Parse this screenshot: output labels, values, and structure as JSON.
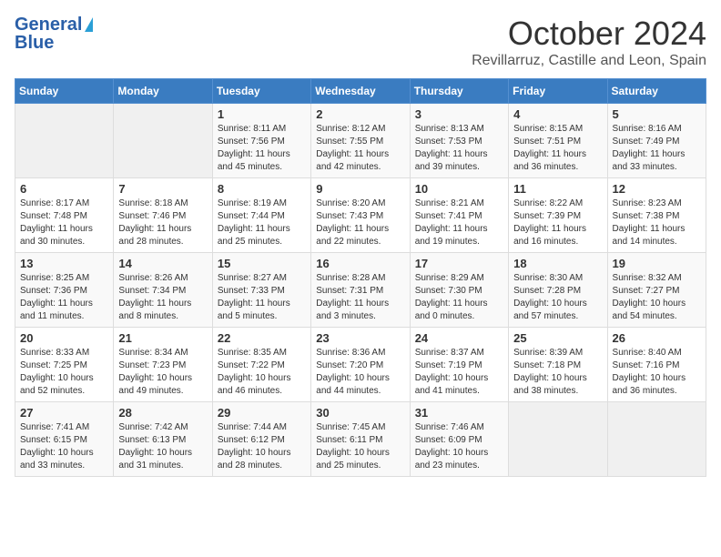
{
  "logo": {
    "line1": "General",
    "line2": "Blue"
  },
  "header": {
    "month": "October 2024",
    "location": "Revillarruz, Castille and Leon, Spain"
  },
  "weekdays": [
    "Sunday",
    "Monday",
    "Tuesday",
    "Wednesday",
    "Thursday",
    "Friday",
    "Saturday"
  ],
  "weeks": [
    [
      {
        "day": "",
        "empty": true
      },
      {
        "day": "",
        "empty": true
      },
      {
        "day": "1",
        "sunrise": "Sunrise: 8:11 AM",
        "sunset": "Sunset: 7:56 PM",
        "daylight": "Daylight: 11 hours and 45 minutes."
      },
      {
        "day": "2",
        "sunrise": "Sunrise: 8:12 AM",
        "sunset": "Sunset: 7:55 PM",
        "daylight": "Daylight: 11 hours and 42 minutes."
      },
      {
        "day": "3",
        "sunrise": "Sunrise: 8:13 AM",
        "sunset": "Sunset: 7:53 PM",
        "daylight": "Daylight: 11 hours and 39 minutes."
      },
      {
        "day": "4",
        "sunrise": "Sunrise: 8:15 AM",
        "sunset": "Sunset: 7:51 PM",
        "daylight": "Daylight: 11 hours and 36 minutes."
      },
      {
        "day": "5",
        "sunrise": "Sunrise: 8:16 AM",
        "sunset": "Sunset: 7:49 PM",
        "daylight": "Daylight: 11 hours and 33 minutes."
      }
    ],
    [
      {
        "day": "6",
        "sunrise": "Sunrise: 8:17 AM",
        "sunset": "Sunset: 7:48 PM",
        "daylight": "Daylight: 11 hours and 30 minutes."
      },
      {
        "day": "7",
        "sunrise": "Sunrise: 8:18 AM",
        "sunset": "Sunset: 7:46 PM",
        "daylight": "Daylight: 11 hours and 28 minutes."
      },
      {
        "day": "8",
        "sunrise": "Sunrise: 8:19 AM",
        "sunset": "Sunset: 7:44 PM",
        "daylight": "Daylight: 11 hours and 25 minutes."
      },
      {
        "day": "9",
        "sunrise": "Sunrise: 8:20 AM",
        "sunset": "Sunset: 7:43 PM",
        "daylight": "Daylight: 11 hours and 22 minutes."
      },
      {
        "day": "10",
        "sunrise": "Sunrise: 8:21 AM",
        "sunset": "Sunset: 7:41 PM",
        "daylight": "Daylight: 11 hours and 19 minutes."
      },
      {
        "day": "11",
        "sunrise": "Sunrise: 8:22 AM",
        "sunset": "Sunset: 7:39 PM",
        "daylight": "Daylight: 11 hours and 16 minutes."
      },
      {
        "day": "12",
        "sunrise": "Sunrise: 8:23 AM",
        "sunset": "Sunset: 7:38 PM",
        "daylight": "Daylight: 11 hours and 14 minutes."
      }
    ],
    [
      {
        "day": "13",
        "sunrise": "Sunrise: 8:25 AM",
        "sunset": "Sunset: 7:36 PM",
        "daylight": "Daylight: 11 hours and 11 minutes."
      },
      {
        "day": "14",
        "sunrise": "Sunrise: 8:26 AM",
        "sunset": "Sunset: 7:34 PM",
        "daylight": "Daylight: 11 hours and 8 minutes."
      },
      {
        "day": "15",
        "sunrise": "Sunrise: 8:27 AM",
        "sunset": "Sunset: 7:33 PM",
        "daylight": "Daylight: 11 hours and 5 minutes."
      },
      {
        "day": "16",
        "sunrise": "Sunrise: 8:28 AM",
        "sunset": "Sunset: 7:31 PM",
        "daylight": "Daylight: 11 hours and 3 minutes."
      },
      {
        "day": "17",
        "sunrise": "Sunrise: 8:29 AM",
        "sunset": "Sunset: 7:30 PM",
        "daylight": "Daylight: 11 hours and 0 minutes."
      },
      {
        "day": "18",
        "sunrise": "Sunrise: 8:30 AM",
        "sunset": "Sunset: 7:28 PM",
        "daylight": "Daylight: 10 hours and 57 minutes."
      },
      {
        "day": "19",
        "sunrise": "Sunrise: 8:32 AM",
        "sunset": "Sunset: 7:27 PM",
        "daylight": "Daylight: 10 hours and 54 minutes."
      }
    ],
    [
      {
        "day": "20",
        "sunrise": "Sunrise: 8:33 AM",
        "sunset": "Sunset: 7:25 PM",
        "daylight": "Daylight: 10 hours and 52 minutes."
      },
      {
        "day": "21",
        "sunrise": "Sunrise: 8:34 AM",
        "sunset": "Sunset: 7:23 PM",
        "daylight": "Daylight: 10 hours and 49 minutes."
      },
      {
        "day": "22",
        "sunrise": "Sunrise: 8:35 AM",
        "sunset": "Sunset: 7:22 PM",
        "daylight": "Daylight: 10 hours and 46 minutes."
      },
      {
        "day": "23",
        "sunrise": "Sunrise: 8:36 AM",
        "sunset": "Sunset: 7:20 PM",
        "daylight": "Daylight: 10 hours and 44 minutes."
      },
      {
        "day": "24",
        "sunrise": "Sunrise: 8:37 AM",
        "sunset": "Sunset: 7:19 PM",
        "daylight": "Daylight: 10 hours and 41 minutes."
      },
      {
        "day": "25",
        "sunrise": "Sunrise: 8:39 AM",
        "sunset": "Sunset: 7:18 PM",
        "daylight": "Daylight: 10 hours and 38 minutes."
      },
      {
        "day": "26",
        "sunrise": "Sunrise: 8:40 AM",
        "sunset": "Sunset: 7:16 PM",
        "daylight": "Daylight: 10 hours and 36 minutes."
      }
    ],
    [
      {
        "day": "27",
        "sunrise": "Sunrise: 7:41 AM",
        "sunset": "Sunset: 6:15 PM",
        "daylight": "Daylight: 10 hours and 33 minutes."
      },
      {
        "day": "28",
        "sunrise": "Sunrise: 7:42 AM",
        "sunset": "Sunset: 6:13 PM",
        "daylight": "Daylight: 10 hours and 31 minutes."
      },
      {
        "day": "29",
        "sunrise": "Sunrise: 7:44 AM",
        "sunset": "Sunset: 6:12 PM",
        "daylight": "Daylight: 10 hours and 28 minutes."
      },
      {
        "day": "30",
        "sunrise": "Sunrise: 7:45 AM",
        "sunset": "Sunset: 6:11 PM",
        "daylight": "Daylight: 10 hours and 25 minutes."
      },
      {
        "day": "31",
        "sunrise": "Sunrise: 7:46 AM",
        "sunset": "Sunset: 6:09 PM",
        "daylight": "Daylight: 10 hours and 23 minutes."
      },
      {
        "day": "",
        "empty": true
      },
      {
        "day": "",
        "empty": true
      }
    ]
  ]
}
